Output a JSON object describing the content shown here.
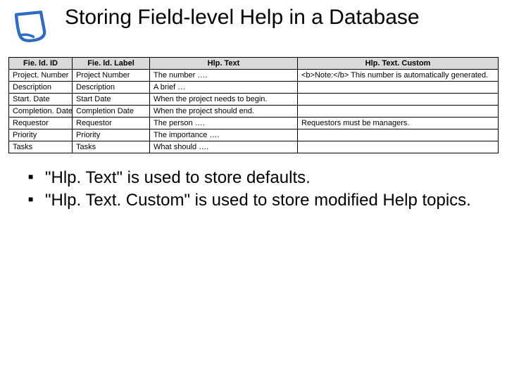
{
  "title": "Storing Field-level Help in a Database",
  "icon": "page-icon",
  "table": {
    "headers": [
      "Fie. ld. ID",
      "Fie. ld. Label",
      "Hlp. Text",
      "Hlp. Text. Custom"
    ],
    "rows": [
      {
        "id": "Project. Number",
        "label": "Project Number",
        "text": "The number ….",
        "custom": "<b>Note:</b> This number is automatically generated."
      },
      {
        "id": "Description",
        "label": "Description",
        "text": "A brief …",
        "custom": ""
      },
      {
        "id": "Start. Date",
        "label": "Start Date",
        "text": "When the project needs to begin.",
        "custom": ""
      },
      {
        "id": "Completion. Date",
        "label": "Completion Date",
        "text": "When the project should end.",
        "custom": ""
      },
      {
        "id": "Requestor",
        "label": "Requestor",
        "text": "The person ….",
        "custom": "Requestors must be managers."
      },
      {
        "id": "Priority",
        "label": "Priority",
        "text": "The importance ….",
        "custom": ""
      },
      {
        "id": "Tasks",
        "label": "Tasks",
        "text": "What should ….",
        "custom": ""
      }
    ]
  },
  "bullets": [
    "\"Hlp. Text\" is used to store defaults.",
    "\"Hlp. Text. Custom\" is used to store modified Help topics."
  ]
}
